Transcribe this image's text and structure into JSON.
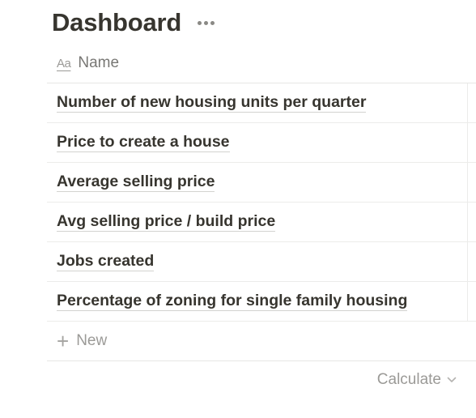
{
  "page": {
    "title": "Dashboard"
  },
  "table": {
    "name_header": "Name",
    "name_icon": "text-property-icon",
    "name_icon_text": "Aa",
    "rows": [
      "Number of new housing units per quarter",
      "Price to create a house",
      "Average selling price",
      "Avg selling price / build price",
      "Jobs created",
      "Percentage of zoning for single family housing"
    ],
    "new_label": "New",
    "calculate_label": "Calculate"
  }
}
